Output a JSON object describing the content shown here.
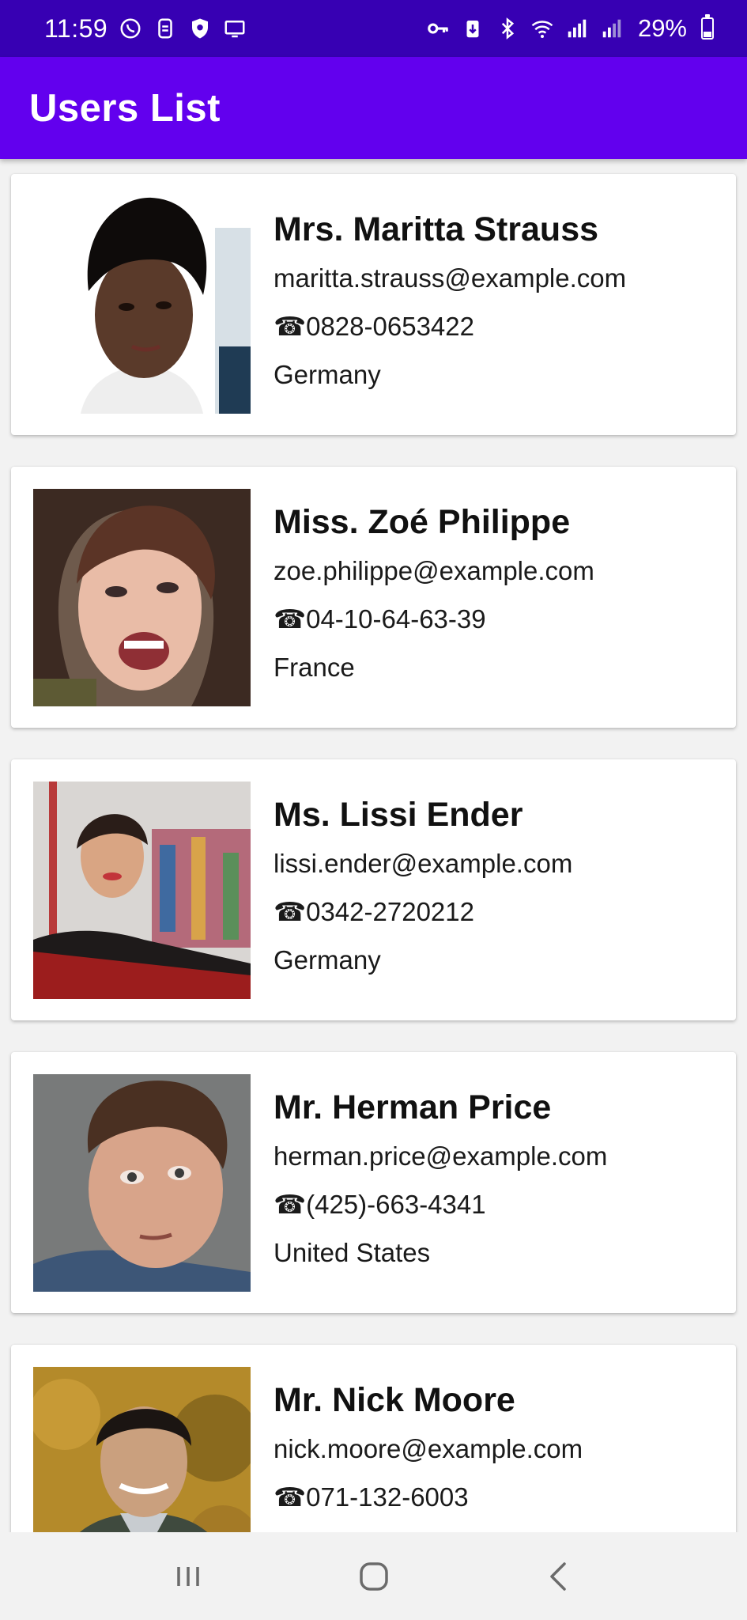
{
  "status_bar": {
    "time": "11:59",
    "battery": "29%",
    "battery_level": 0.29,
    "icons_left": [
      "whatsapp-icon",
      "sim-icon",
      "vpn-shield-icon",
      "cast-screen-icon"
    ],
    "icons_right": [
      "key-icon",
      "battery-saver-icon",
      "bluetooth-icon",
      "wifi-icon",
      "signal-icon",
      "signal-icon-2"
    ]
  },
  "app_bar": {
    "title": "Users List"
  },
  "users": [
    {
      "name": "Mrs. Maritta Strauss",
      "email": "maritta.strauss@example.com",
      "phone": "☎0828-0653422",
      "country": "Germany"
    },
    {
      "name": "Miss. Zoé Philippe",
      "email": "zoe.philippe@example.com",
      "phone": "☎04-10-64-63-39",
      "country": "France"
    },
    {
      "name": "Ms. Lissi Ender",
      "email": "lissi.ender@example.com",
      "phone": "☎0342-2720212",
      "country": "Germany"
    },
    {
      "name": "Mr. Herman Price",
      "email": "herman.price@example.com",
      "phone": "☎(425)-663-4341",
      "country": "United States"
    },
    {
      "name": "Mr. Nick Moore",
      "email": "nick.moore@example.com",
      "phone": "☎071-132-6003",
      "country": ""
    }
  ],
  "nav_bar": {
    "icons": [
      "recent-apps-icon",
      "home-icon",
      "back-icon"
    ]
  },
  "colors": {
    "status_bar": "#3700b3",
    "app_bar": "#6200ee",
    "background": "#f2f2f2",
    "card": "#ffffff"
  }
}
